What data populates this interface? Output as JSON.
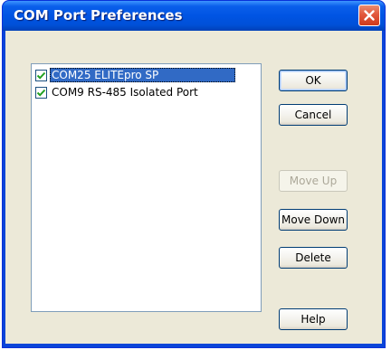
{
  "window": {
    "title": "COM Port Preferences"
  },
  "ports": [
    {
      "label": "COM25 ELITEpro SP",
      "checked": true,
      "selected": true
    },
    {
      "label": "COM9 RS-485 Isolated Port",
      "checked": true,
      "selected": false
    }
  ],
  "buttons": {
    "ok": "OK",
    "cancel": "Cancel",
    "move_up": "Move Up",
    "move_down": "Move Down",
    "delete": "Delete",
    "help": "Help"
  },
  "icons": {
    "close": "close-icon",
    "check": "check-icon"
  },
  "colors": {
    "titlebar": "#0054e3",
    "selection": "#316ac5",
    "check": "#21a121",
    "close": "#e2583c",
    "dialog_bg": "#ece9d8"
  }
}
